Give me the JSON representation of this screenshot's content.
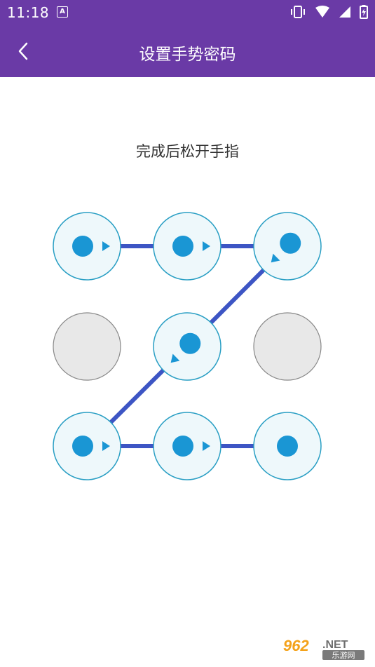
{
  "status_bar": {
    "time": "11:18",
    "notification_badge": "A",
    "icons": [
      "vibrate-icon",
      "wifi-icon",
      "signal-icon",
      "battery-icon"
    ]
  },
  "toolbar": {
    "title": "设置手势密码",
    "back_icon": "chevron-left-icon"
  },
  "hint": "完成后松开手指",
  "pattern": {
    "grid": [
      [
        "selected",
        "selected",
        "selected"
      ],
      [
        "unselected",
        "selected",
        "unselected"
      ],
      [
        "selected",
        "selected",
        "selected"
      ]
    ],
    "sequence": [
      1,
      2,
      3,
      5,
      7,
      8,
      9
    ]
  },
  "watermark": {
    "brand": "962.NET",
    "caption": "乐游网"
  },
  "colors": {
    "accent": "#6a3aa6",
    "line": "#3d55c4",
    "dot": "#1a96d4",
    "node_fill": "#eef8fb",
    "node_border": "#2a9fc4",
    "inactive_fill": "#e8e8e8",
    "inactive_border": "#888888"
  }
}
